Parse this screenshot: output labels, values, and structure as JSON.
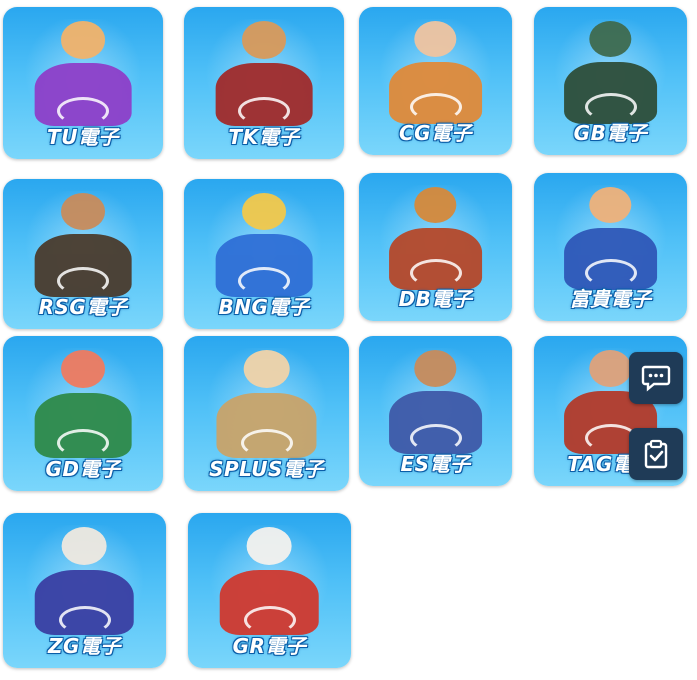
{
  "games": [
    {
      "id": "tu",
      "label": "TU電子",
      "head": "#f2b36b",
      "body": "#8e3fc9"
    },
    {
      "id": "tk",
      "label": "TK電子",
      "head": "#d99a5b",
      "body": "#a12b2b"
    },
    {
      "id": "cg",
      "label": "CG電子",
      "head": "#f0c4a0",
      "body": "#e08a3a"
    },
    {
      "id": "gb",
      "label": "GB電子",
      "head": "#3f6b4f",
      "body": "#2e4e3a"
    },
    {
      "id": "rsg",
      "label": "RSG電子",
      "head": "#c98c5b",
      "body": "#4a3b2d"
    },
    {
      "id": "bng",
      "label": "BNG電子",
      "head": "#f3c94a",
      "body": "#2f6fd6"
    },
    {
      "id": "db",
      "label": "DB電子",
      "head": "#d68a3a",
      "body": "#b6482a"
    },
    {
      "id": "fugui",
      "label": "富貴電子",
      "head": "#f0b27a",
      "body": "#2f58b8"
    },
    {
      "id": "gd",
      "label": "GD電子",
      "head": "#f07b5f",
      "body": "#2f8a4a"
    },
    {
      "id": "splus",
      "label": "SPLUS電子",
      "head": "#f2d3a8",
      "body": "#c9a46a"
    },
    {
      "id": "es",
      "label": "ES電子",
      "head": "#c98c5b",
      "body": "#3f5aa8"
    },
    {
      "id": "tag",
      "label": "TAG電子",
      "head": "#e0a27a",
      "body": "#b33a2a"
    },
    {
      "id": "zg",
      "label": "ZG電子",
      "head": "#efe9e0",
      "body": "#3a3fa3"
    },
    {
      "id": "gr",
      "label": "GR電子",
      "head": "#f4f2ee",
      "body": "#d0392f"
    }
  ],
  "fabs": {
    "chat_icon": "chat-bubble-icon",
    "clipboard_icon": "clipboard-check-icon"
  },
  "colors": {
    "tile_top": "#2aa7ef",
    "tile_bottom": "#7ad6fb",
    "fab_bg": "#1f3b57"
  }
}
